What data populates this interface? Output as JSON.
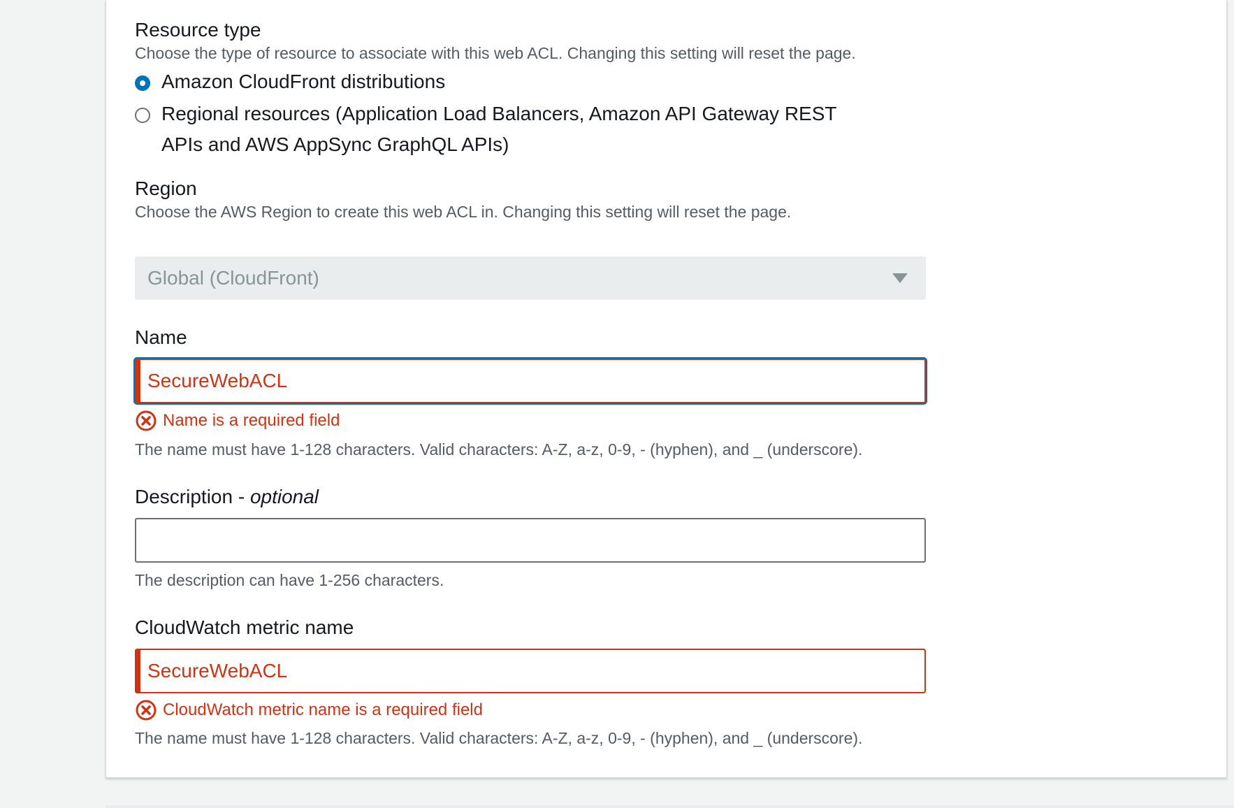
{
  "resource_type": {
    "label": "Resource type",
    "description": "Choose the type of resource to associate with this web ACL. Changing this setting will reset the page.",
    "options": [
      {
        "label": "Amazon CloudFront distributions",
        "selected": true
      },
      {
        "label": "Regional resources (Application Load Balancers, Amazon API Gateway REST APIs and AWS AppSync GraphQL APIs)",
        "selected": false
      }
    ]
  },
  "region": {
    "label": "Region",
    "description": "Choose the AWS Region to create this web ACL in. Changing this setting will reset the page.",
    "selected_value": "Global (CloudFront)",
    "disabled": true
  },
  "name": {
    "label": "Name",
    "value": "SecureWebACL",
    "error": "Name is a required field",
    "constraint": "The name must have 1-128 characters. Valid characters: A-Z, a-z, 0-9, - (hyphen), and _ (underscore)."
  },
  "description": {
    "label": "Description - ",
    "label_optional": "optional",
    "value": "",
    "constraint": "The description can have 1-256 characters."
  },
  "metric_name": {
    "label": "CloudWatch metric name",
    "value": "SecureWebACL",
    "error": "CloudWatch metric name is a required field",
    "constraint": "The name must have 1-128 characters. Valid characters: A-Z, a-z, 0-9, - (hyphen), and _ (underscore)."
  },
  "colors": {
    "accent": "#0073bb",
    "error": "#d13212",
    "text": "#16191f",
    "secondary_text": "#545b64"
  }
}
